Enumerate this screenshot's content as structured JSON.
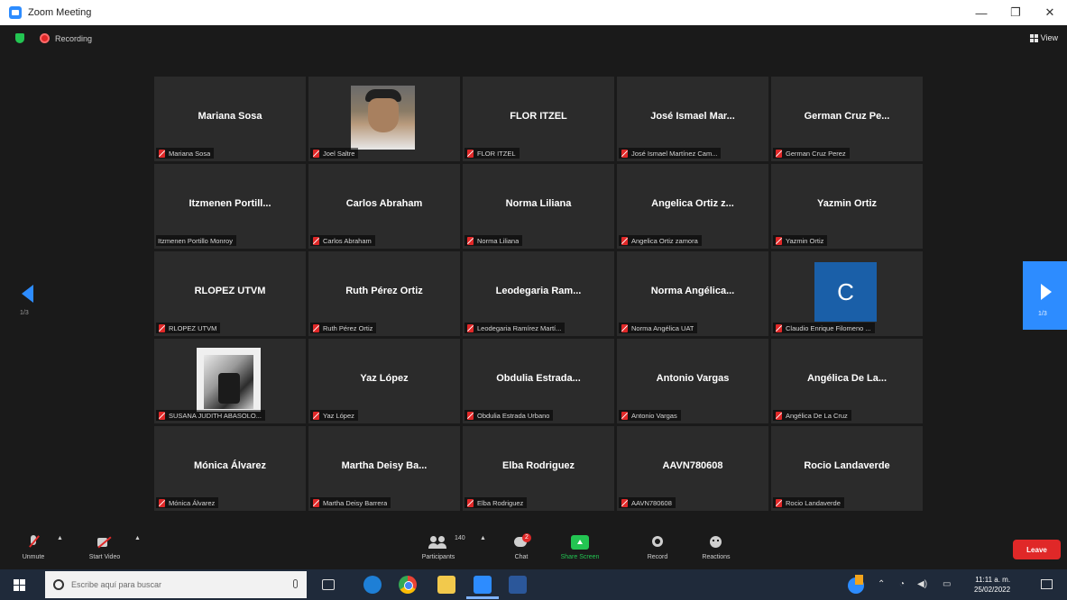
{
  "window": {
    "title": "Zoom Meeting",
    "minimize": "—",
    "restore": "❐",
    "close": "✕"
  },
  "topbar": {
    "recording_label": "Recording",
    "view_label": "View"
  },
  "participants": [
    {
      "display": "Mariana Sosa",
      "tag": "Mariana Sosa",
      "muted": true
    },
    {
      "display": "",
      "tag": "Joel Saltre",
      "muted": true,
      "photo": "face"
    },
    {
      "display": "FLOR ITZEL",
      "tag": "FLOR ITZEL",
      "muted": true
    },
    {
      "display": "José Ismael Mar...",
      "tag": "José Ismael Martínez Cam...",
      "muted": true
    },
    {
      "display": "German Cruz Pe...",
      "tag": "German Cruz Perez",
      "muted": true
    },
    {
      "display": "Itzmenen Portill...",
      "tag": "Itzmenen Portillo Monroy",
      "muted": false
    },
    {
      "display": "Carlos Abraham",
      "tag": "Carlos Abraham",
      "muted": true
    },
    {
      "display": "Norma Liliana",
      "tag": "Norma Liliana",
      "muted": true
    },
    {
      "display": "Angelica Ortiz z...",
      "tag": "Angelica Ortiz zamora",
      "muted": true
    },
    {
      "display": "Yazmin Ortiz",
      "tag": "Yazmin Ortiz",
      "muted": true
    },
    {
      "display": "RLOPEZ UTVM",
      "tag": "RLOPEZ UTVM",
      "muted": true
    },
    {
      "display": "Ruth Pérez Ortiz",
      "tag": "Ruth Pérez Ortiz",
      "muted": true
    },
    {
      "display": "Leodegaria Ram...",
      "tag": "Leodegaria Ramírez Martí...",
      "muted": true
    },
    {
      "display": "Norma Angélica...",
      "tag": "Norma Angélica UAT",
      "muted": true
    },
    {
      "display": "",
      "tag": "Claudio Enrique Filomeno ...",
      "muted": true,
      "avatar_letter": "C"
    },
    {
      "display": "",
      "tag": "SUSANA JUDITH ABASOLO...",
      "muted": true,
      "photo": "bw"
    },
    {
      "display": "Yaz López",
      "tag": "Yaz López",
      "muted": true
    },
    {
      "display": "Obdulia Estrada...",
      "tag": "Obdulia Estrada Urbano",
      "muted": true
    },
    {
      "display": "Antonio Vargas",
      "tag": "Antonio Vargas",
      "muted": true
    },
    {
      "display": "Angélica De La...",
      "tag": "Angélica De La Cruz",
      "muted": true
    },
    {
      "display": "Mónica Álvarez",
      "tag": "Mónica Álvarez",
      "muted": true
    },
    {
      "display": "Martha Deisy Ba...",
      "tag": "Martha Deisy Barrera",
      "muted": true
    },
    {
      "display": "Elba Rodriguez",
      "tag": "Elba Rodriguez",
      "muted": true
    },
    {
      "display": "AAVN780608",
      "tag": "AAVN780608",
      "muted": true
    },
    {
      "display": "Rocio Landaverde",
      "tag": "Rocio Landaverde",
      "muted": true
    }
  ],
  "pager": {
    "left_page": "1/3",
    "right_page": "1/3"
  },
  "toolbar": {
    "unmute_label": "Unmute",
    "start_video_label": "Start Video",
    "participants_label": "Participants",
    "participants_count": "140",
    "chat_label": "Chat",
    "chat_badge": "2",
    "share_label": "Share Screen",
    "record_label": "Record",
    "reactions_label": "Reactions",
    "leave_label": "Leave"
  },
  "taskbar": {
    "search_placeholder": "Escribe aquí para buscar",
    "time": "11:11 a. m.",
    "date": "25/02/2022"
  },
  "colors": {
    "zoom_blue": "#2d8cff",
    "recording_red": "#e02828",
    "share_green": "#23c552",
    "tile_bg": "#2b2b2b"
  },
  "icons": [
    "zoom-app-icon",
    "shield-icon",
    "record-dot-icon",
    "grid-view-icon",
    "mute-icon",
    "arrow-left-icon",
    "arrow-right-icon",
    "mic-icon",
    "camera-icon",
    "participants-icon",
    "chat-icon",
    "share-screen-icon",
    "record-icon",
    "reactions-icon",
    "windows-icon",
    "search-icon"
  ]
}
